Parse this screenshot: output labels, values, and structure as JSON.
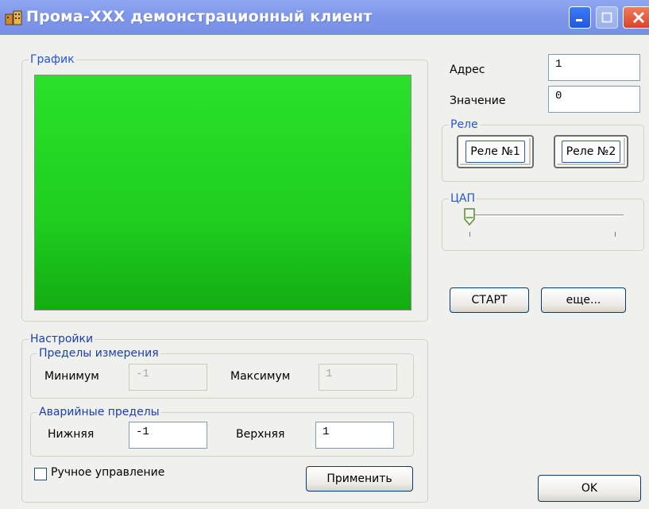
{
  "window": {
    "title": "Прома-XXX демонстрационный клиент"
  },
  "graph_group": {
    "legend": "График"
  },
  "address": {
    "label": "Адрес",
    "value": "1"
  },
  "value_field": {
    "label": "Значение",
    "value": "0"
  },
  "relay_group": {
    "legend": "Реле",
    "relay1_label": "Реле №1",
    "relay2_label": "Реле №2"
  },
  "dac_group": {
    "legend": "ЦАП",
    "slider_value": 0
  },
  "start_button": "СТАРТ",
  "more_button": "еще...",
  "settings": {
    "legend": "Настройки",
    "measure_limits": {
      "legend": "Пределы измерения",
      "min_label": "Минимум",
      "min_value": "-1",
      "max_label": "Максимум",
      "max_value": "1"
    },
    "alarm_limits": {
      "legend": "Аварийные пределы",
      "low_label": "Нижняя",
      "low_value": "-1",
      "high_label": "Верхняя",
      "high_value": "1"
    },
    "manual_control_label": "Ручное управление",
    "manual_control_checked": false,
    "apply_button": "Применить"
  },
  "ok_button": "OK",
  "colors": {
    "titlebar": "#7f97ea",
    "graph_green": "#1fcf1f",
    "legend_blue": "#2255dd"
  }
}
